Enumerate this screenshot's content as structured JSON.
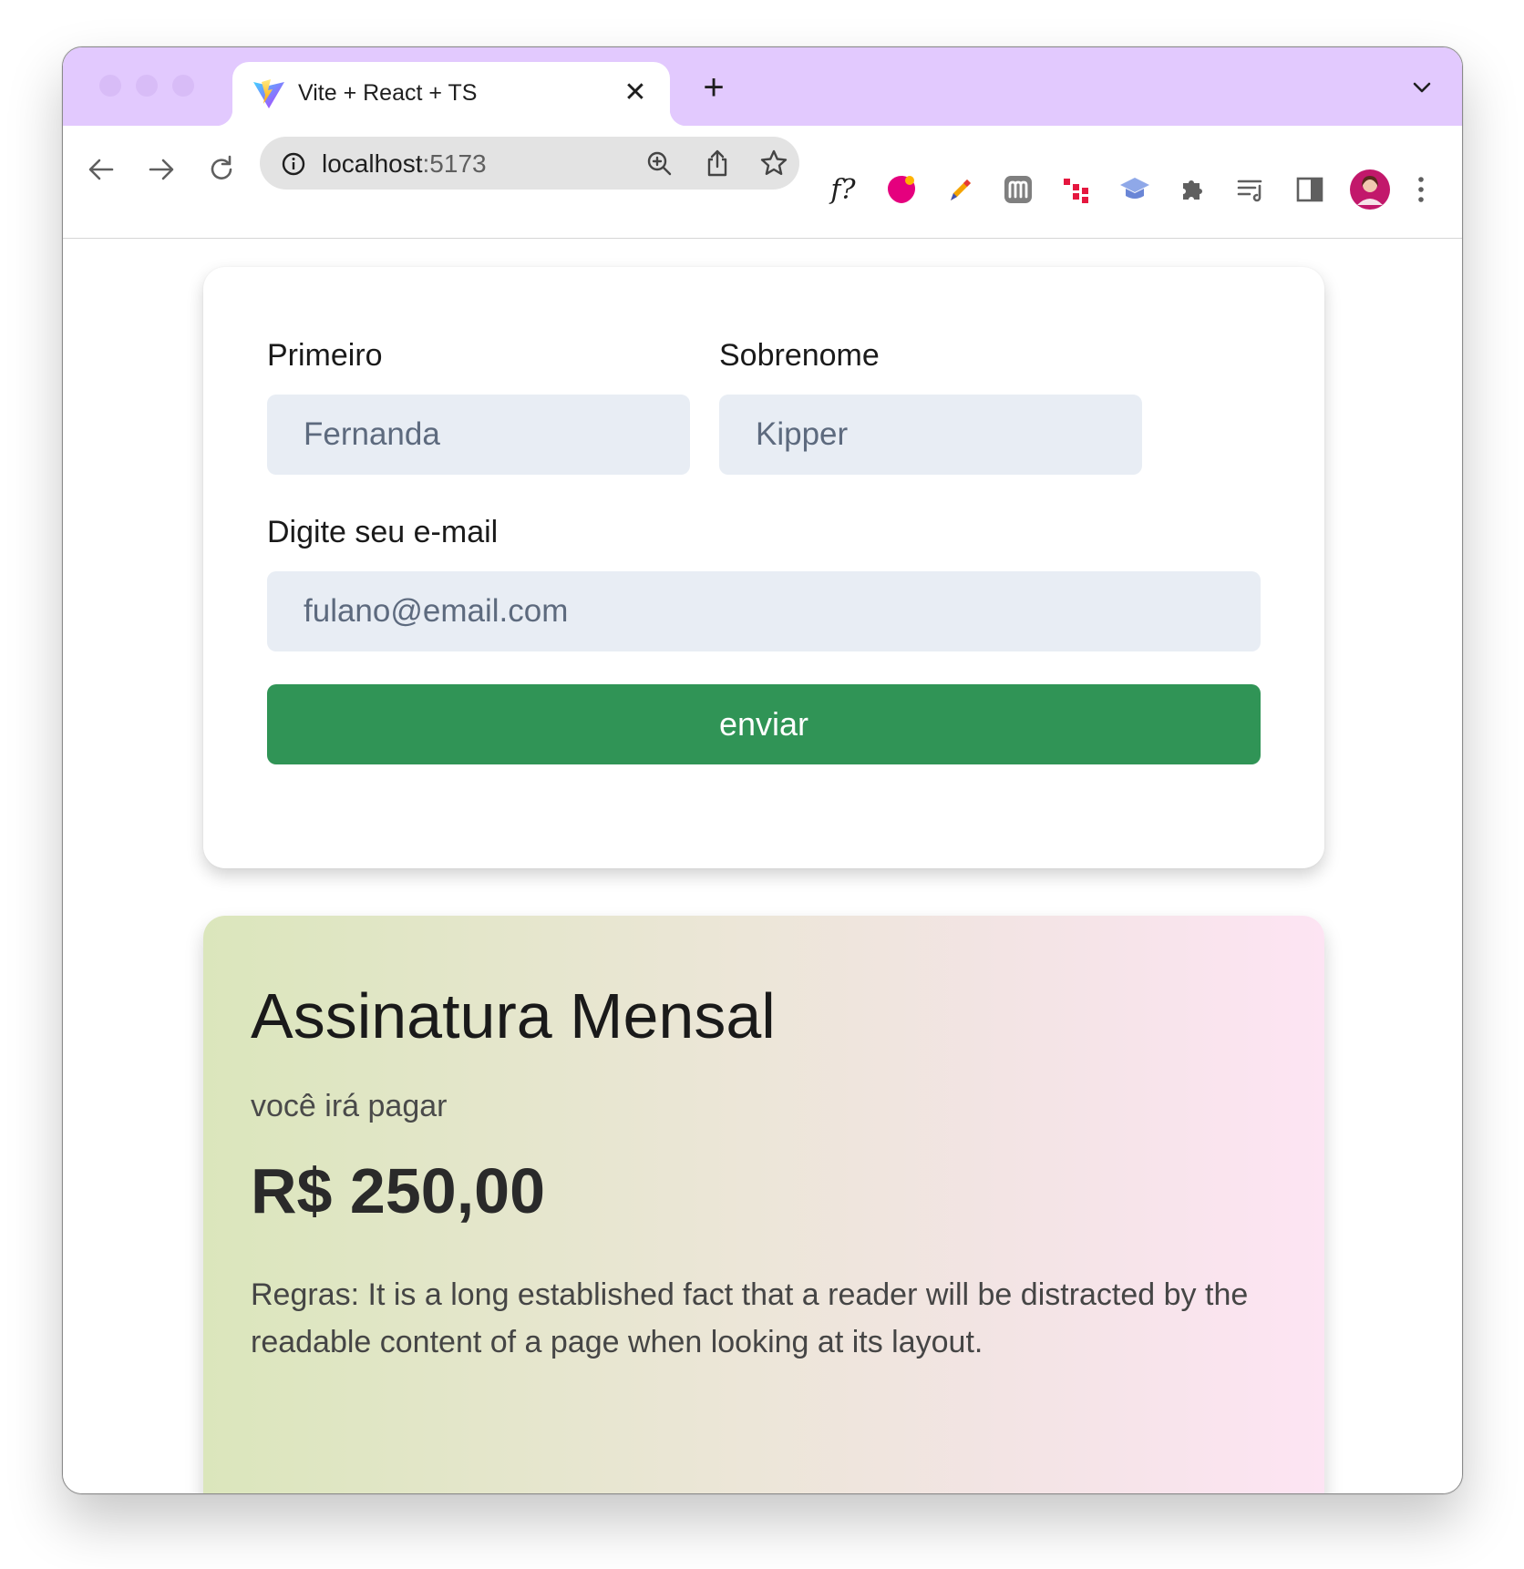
{
  "browser": {
    "tab_title": "Vite + React + TS",
    "new_tab_label": "+",
    "close_tab_label": "✕",
    "address_host": "localhost",
    "address_port": ":5173",
    "extensions": [
      "f?"
    ]
  },
  "form": {
    "first_name_label": "Primeiro",
    "first_name_placeholder": "Fernanda",
    "last_name_label": "Sobrenome",
    "last_name_placeholder": "Kipper",
    "email_label": "Digite seu e-mail",
    "email_placeholder": "fulano@email.com",
    "submit_label": "enviar",
    "submit_color": "#309456"
  },
  "plan": {
    "title": "Assinatura Mensal",
    "subtitle": "você irá pagar",
    "price": "R$ 250,00",
    "rules": "Regras: It is a long established fact that a reader will be distracted by the readable content of a page when looking at its layout."
  },
  "colors": {
    "tabstrip": "#e2c9fe",
    "field_bg": "#e8edf4",
    "gradient_start": "#dbe6bc",
    "gradient_end": "#fde4f3"
  },
  "icons": [
    "vite-favicon-icon",
    "back-arrow-icon",
    "forward-arrow-icon",
    "reload-icon",
    "site-info-icon",
    "zoom-icon",
    "share-icon",
    "bookmark-star-icon",
    "extension-puzzle-icon",
    "reading-list-icon",
    "side-panel-icon",
    "more-menu-icon"
  ]
}
